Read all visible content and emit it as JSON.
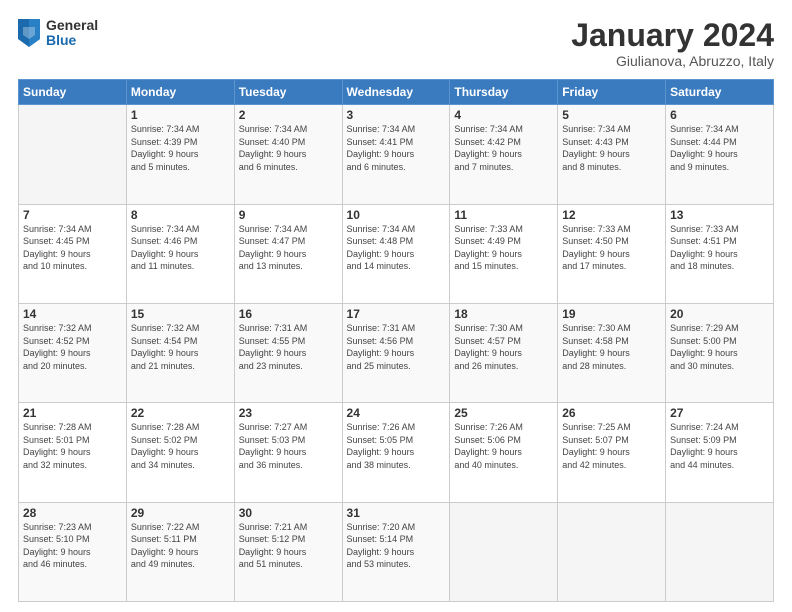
{
  "logo": {
    "general": "General",
    "blue": "Blue"
  },
  "header": {
    "month": "January 2024",
    "location": "Giulianova, Abruzzo, Italy"
  },
  "weekdays": [
    "Sunday",
    "Monday",
    "Tuesday",
    "Wednesday",
    "Thursday",
    "Friday",
    "Saturday"
  ],
  "weeks": [
    [
      {
        "day": "",
        "info": ""
      },
      {
        "day": "1",
        "info": "Sunrise: 7:34 AM\nSunset: 4:39 PM\nDaylight: 9 hours\nand 5 minutes."
      },
      {
        "day": "2",
        "info": "Sunrise: 7:34 AM\nSunset: 4:40 PM\nDaylight: 9 hours\nand 6 minutes."
      },
      {
        "day": "3",
        "info": "Sunrise: 7:34 AM\nSunset: 4:41 PM\nDaylight: 9 hours\nand 6 minutes."
      },
      {
        "day": "4",
        "info": "Sunrise: 7:34 AM\nSunset: 4:42 PM\nDaylight: 9 hours\nand 7 minutes."
      },
      {
        "day": "5",
        "info": "Sunrise: 7:34 AM\nSunset: 4:43 PM\nDaylight: 9 hours\nand 8 minutes."
      },
      {
        "day": "6",
        "info": "Sunrise: 7:34 AM\nSunset: 4:44 PM\nDaylight: 9 hours\nand 9 minutes."
      }
    ],
    [
      {
        "day": "7",
        "info": "Sunrise: 7:34 AM\nSunset: 4:45 PM\nDaylight: 9 hours\nand 10 minutes."
      },
      {
        "day": "8",
        "info": "Sunrise: 7:34 AM\nSunset: 4:46 PM\nDaylight: 9 hours\nand 11 minutes."
      },
      {
        "day": "9",
        "info": "Sunrise: 7:34 AM\nSunset: 4:47 PM\nDaylight: 9 hours\nand 13 minutes."
      },
      {
        "day": "10",
        "info": "Sunrise: 7:34 AM\nSunset: 4:48 PM\nDaylight: 9 hours\nand 14 minutes."
      },
      {
        "day": "11",
        "info": "Sunrise: 7:33 AM\nSunset: 4:49 PM\nDaylight: 9 hours\nand 15 minutes."
      },
      {
        "day": "12",
        "info": "Sunrise: 7:33 AM\nSunset: 4:50 PM\nDaylight: 9 hours\nand 17 minutes."
      },
      {
        "day": "13",
        "info": "Sunrise: 7:33 AM\nSunset: 4:51 PM\nDaylight: 9 hours\nand 18 minutes."
      }
    ],
    [
      {
        "day": "14",
        "info": "Sunrise: 7:32 AM\nSunset: 4:52 PM\nDaylight: 9 hours\nand 20 minutes."
      },
      {
        "day": "15",
        "info": "Sunrise: 7:32 AM\nSunset: 4:54 PM\nDaylight: 9 hours\nand 21 minutes."
      },
      {
        "day": "16",
        "info": "Sunrise: 7:31 AM\nSunset: 4:55 PM\nDaylight: 9 hours\nand 23 minutes."
      },
      {
        "day": "17",
        "info": "Sunrise: 7:31 AM\nSunset: 4:56 PM\nDaylight: 9 hours\nand 25 minutes."
      },
      {
        "day": "18",
        "info": "Sunrise: 7:30 AM\nSunset: 4:57 PM\nDaylight: 9 hours\nand 26 minutes."
      },
      {
        "day": "19",
        "info": "Sunrise: 7:30 AM\nSunset: 4:58 PM\nDaylight: 9 hours\nand 28 minutes."
      },
      {
        "day": "20",
        "info": "Sunrise: 7:29 AM\nSunset: 5:00 PM\nDaylight: 9 hours\nand 30 minutes."
      }
    ],
    [
      {
        "day": "21",
        "info": "Sunrise: 7:28 AM\nSunset: 5:01 PM\nDaylight: 9 hours\nand 32 minutes."
      },
      {
        "day": "22",
        "info": "Sunrise: 7:28 AM\nSunset: 5:02 PM\nDaylight: 9 hours\nand 34 minutes."
      },
      {
        "day": "23",
        "info": "Sunrise: 7:27 AM\nSunset: 5:03 PM\nDaylight: 9 hours\nand 36 minutes."
      },
      {
        "day": "24",
        "info": "Sunrise: 7:26 AM\nSunset: 5:05 PM\nDaylight: 9 hours\nand 38 minutes."
      },
      {
        "day": "25",
        "info": "Sunrise: 7:26 AM\nSunset: 5:06 PM\nDaylight: 9 hours\nand 40 minutes."
      },
      {
        "day": "26",
        "info": "Sunrise: 7:25 AM\nSunset: 5:07 PM\nDaylight: 9 hours\nand 42 minutes."
      },
      {
        "day": "27",
        "info": "Sunrise: 7:24 AM\nSunset: 5:09 PM\nDaylight: 9 hours\nand 44 minutes."
      }
    ],
    [
      {
        "day": "28",
        "info": "Sunrise: 7:23 AM\nSunset: 5:10 PM\nDaylight: 9 hours\nand 46 minutes."
      },
      {
        "day": "29",
        "info": "Sunrise: 7:22 AM\nSunset: 5:11 PM\nDaylight: 9 hours\nand 49 minutes."
      },
      {
        "day": "30",
        "info": "Sunrise: 7:21 AM\nSunset: 5:12 PM\nDaylight: 9 hours\nand 51 minutes."
      },
      {
        "day": "31",
        "info": "Sunrise: 7:20 AM\nSunset: 5:14 PM\nDaylight: 9 hours\nand 53 minutes."
      },
      {
        "day": "",
        "info": ""
      },
      {
        "day": "",
        "info": ""
      },
      {
        "day": "",
        "info": ""
      }
    ]
  ]
}
